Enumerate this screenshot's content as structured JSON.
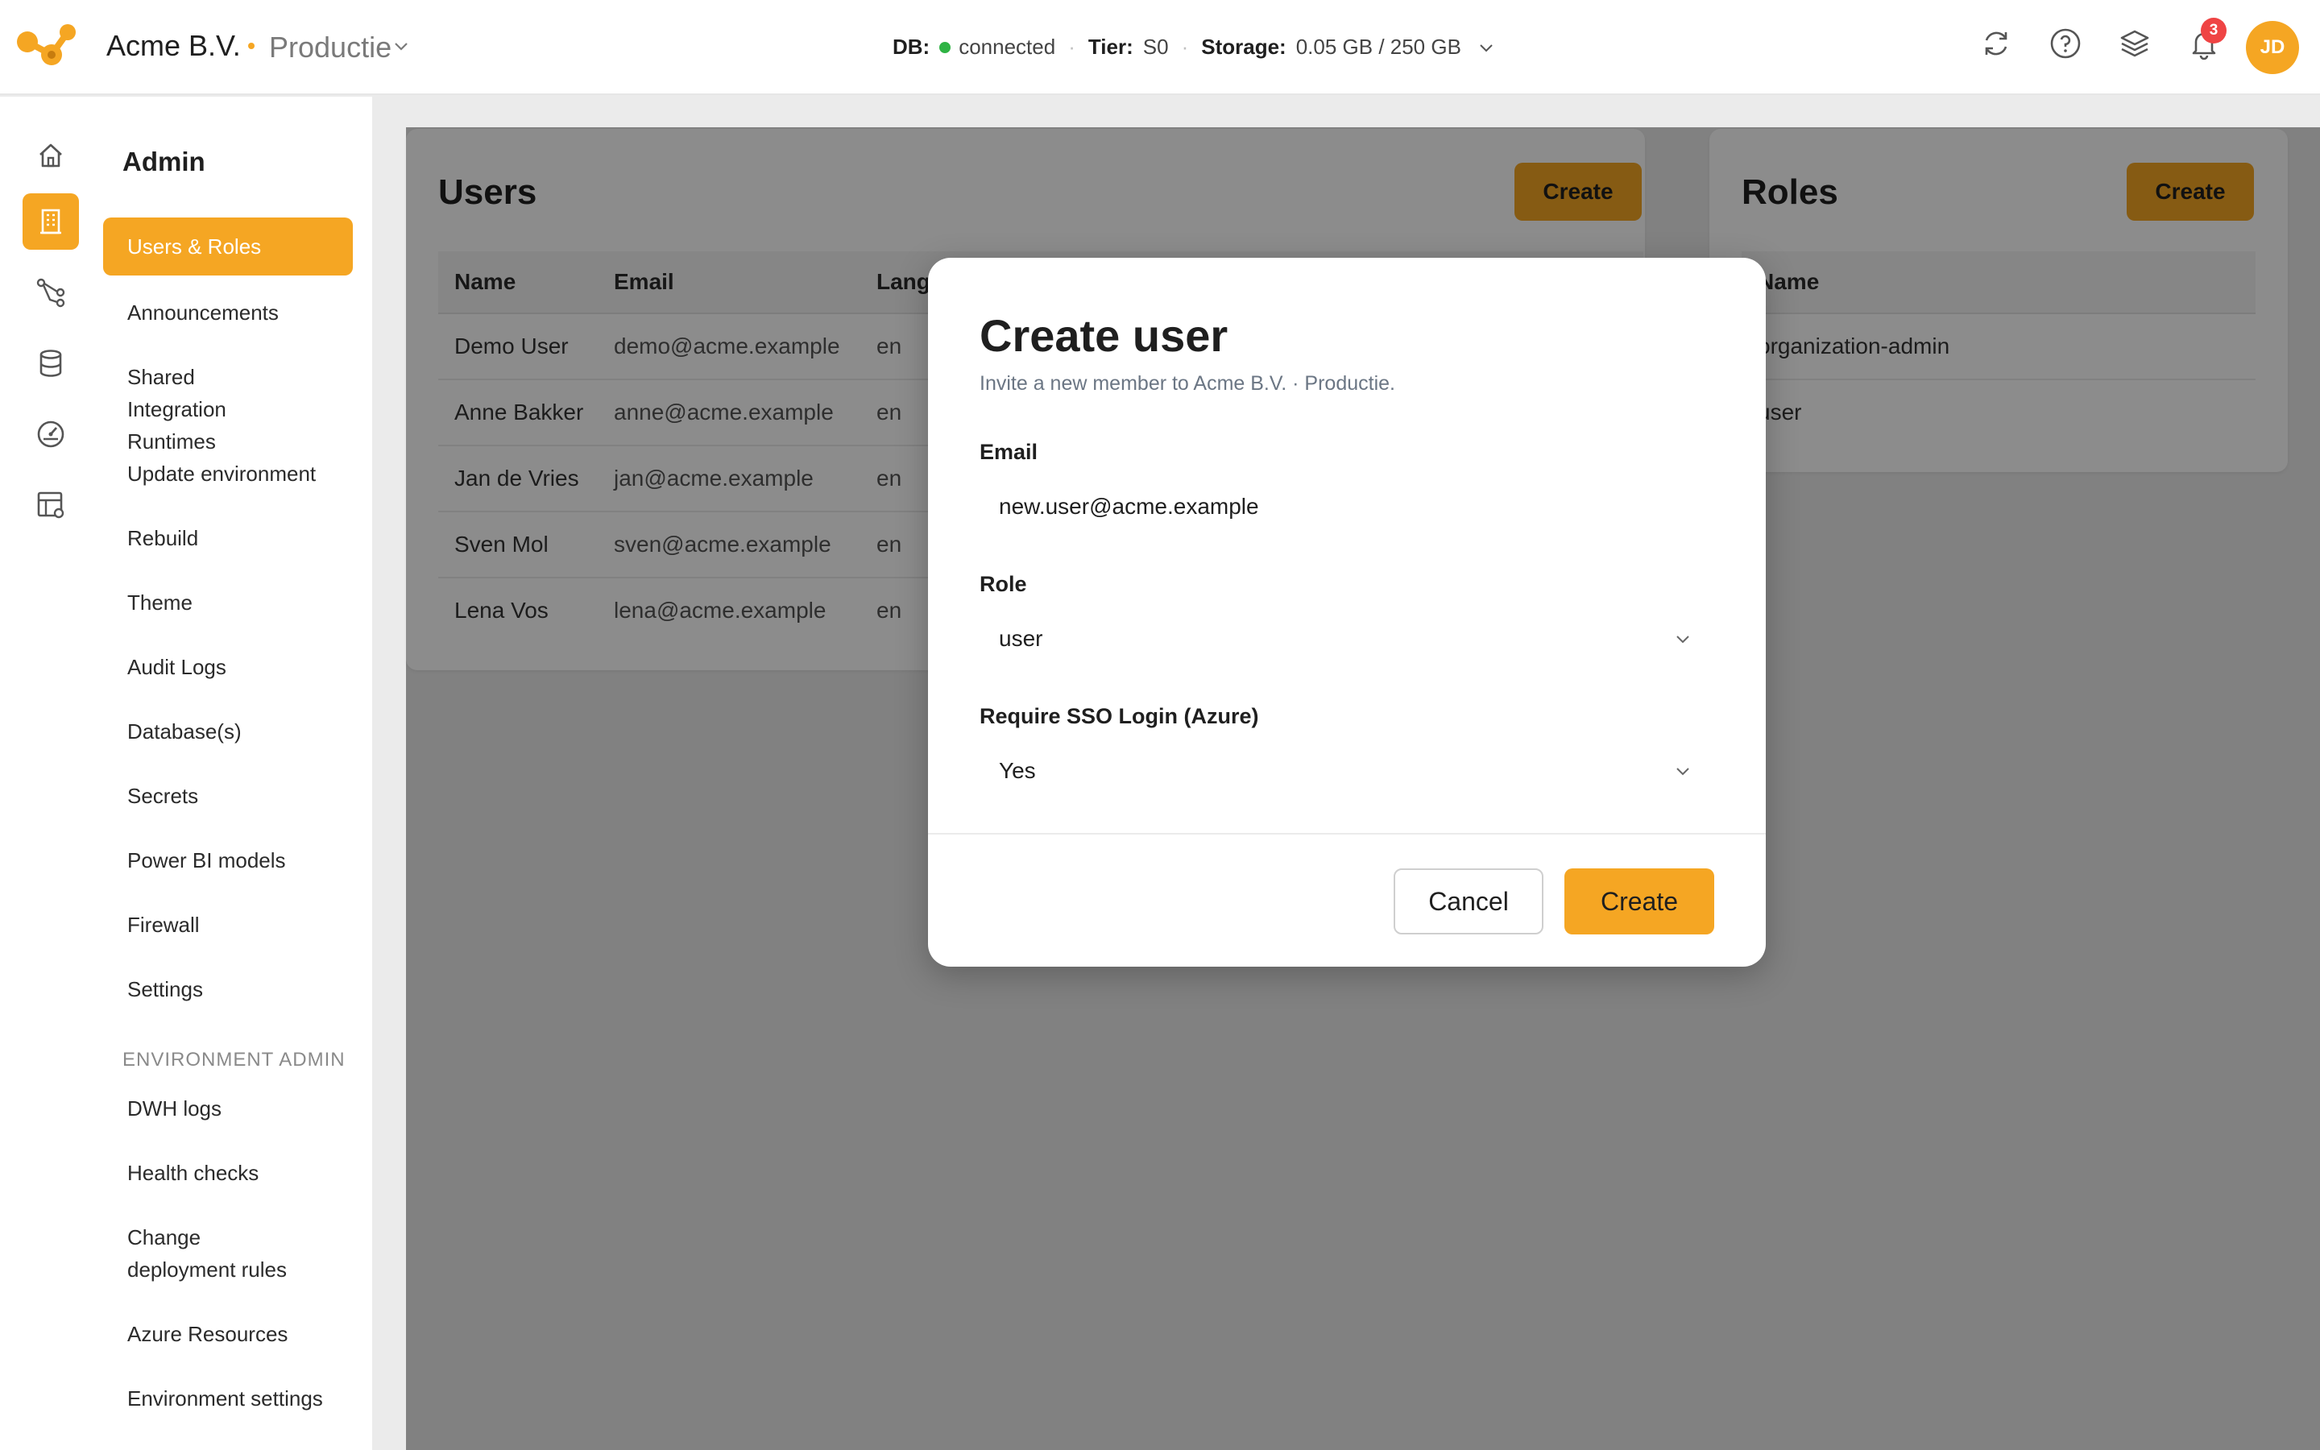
{
  "header": {
    "org_name": "Acme B.V.",
    "environment": "Productie",
    "db_label": "DB:",
    "db_status": "connected",
    "tier_label": "Tier:",
    "tier_value": "S0",
    "storage_label": "Storage:",
    "storage_value": "0.05 GB / 250 GB",
    "notification_count": "3",
    "avatar_initials": "JD"
  },
  "rail": {
    "icons": [
      "home-icon",
      "building-icon",
      "pipeline-icon",
      "database-icon",
      "gauge-icon",
      "table-settings-icon"
    ],
    "active_index": 1
  },
  "sidebar": {
    "title": "Admin",
    "items": [
      {
        "label": "Users & Roles",
        "active": true
      },
      {
        "label": "Announcements"
      },
      {
        "label": "Shared Integration Runtimes"
      },
      {
        "label": "Update environment"
      },
      {
        "label": "Rebuild"
      },
      {
        "label": "Theme"
      },
      {
        "label": "Audit Logs"
      },
      {
        "label": "Database(s)"
      },
      {
        "label": "Secrets"
      },
      {
        "label": "Power BI models"
      },
      {
        "label": "Firewall"
      },
      {
        "label": "Settings"
      }
    ],
    "section_title": "ENVIRONMENT ADMIN",
    "env_items": [
      {
        "label": "DWH logs"
      },
      {
        "label": "Health checks"
      },
      {
        "label": "Change deployment rules"
      },
      {
        "label": "Azure Resources"
      },
      {
        "label": "Environment settings"
      }
    ]
  },
  "users_card": {
    "title": "Users",
    "create_label": "Create",
    "columns": [
      "Name",
      "Email",
      "Lang"
    ],
    "rows": [
      {
        "name": "Demo User",
        "email": "demo@acme.example",
        "lang": "en"
      },
      {
        "name": "Anne Bakker",
        "email": "anne@acme.example",
        "lang": "en"
      },
      {
        "name": "Jan de Vries",
        "email": "jan@acme.example",
        "lang": "en"
      },
      {
        "name": "Sven Mol",
        "email": "sven@acme.example",
        "lang": "en"
      },
      {
        "name": "Lena Vos",
        "email": "lena@acme.example",
        "lang": "en"
      }
    ]
  },
  "roles_card": {
    "title": "Roles",
    "create_label": "Create",
    "columns": [
      "Name"
    ],
    "rows": [
      "organization-admin",
      "user"
    ]
  },
  "modal": {
    "title": "Create user",
    "subtitle": "Invite a new member to Acme B.V. · Productie.",
    "email_label": "Email",
    "email_value": "new.user@acme.example",
    "role_label": "Role",
    "role_value": "user",
    "sso_label": "Require SSO Login (Azure)",
    "sso_value": "Yes",
    "cancel_label": "Cancel",
    "create_label": "Create"
  },
  "colors": {
    "accent": "#f5a623",
    "connected": "#2fb344",
    "badge": "#ef4444"
  }
}
